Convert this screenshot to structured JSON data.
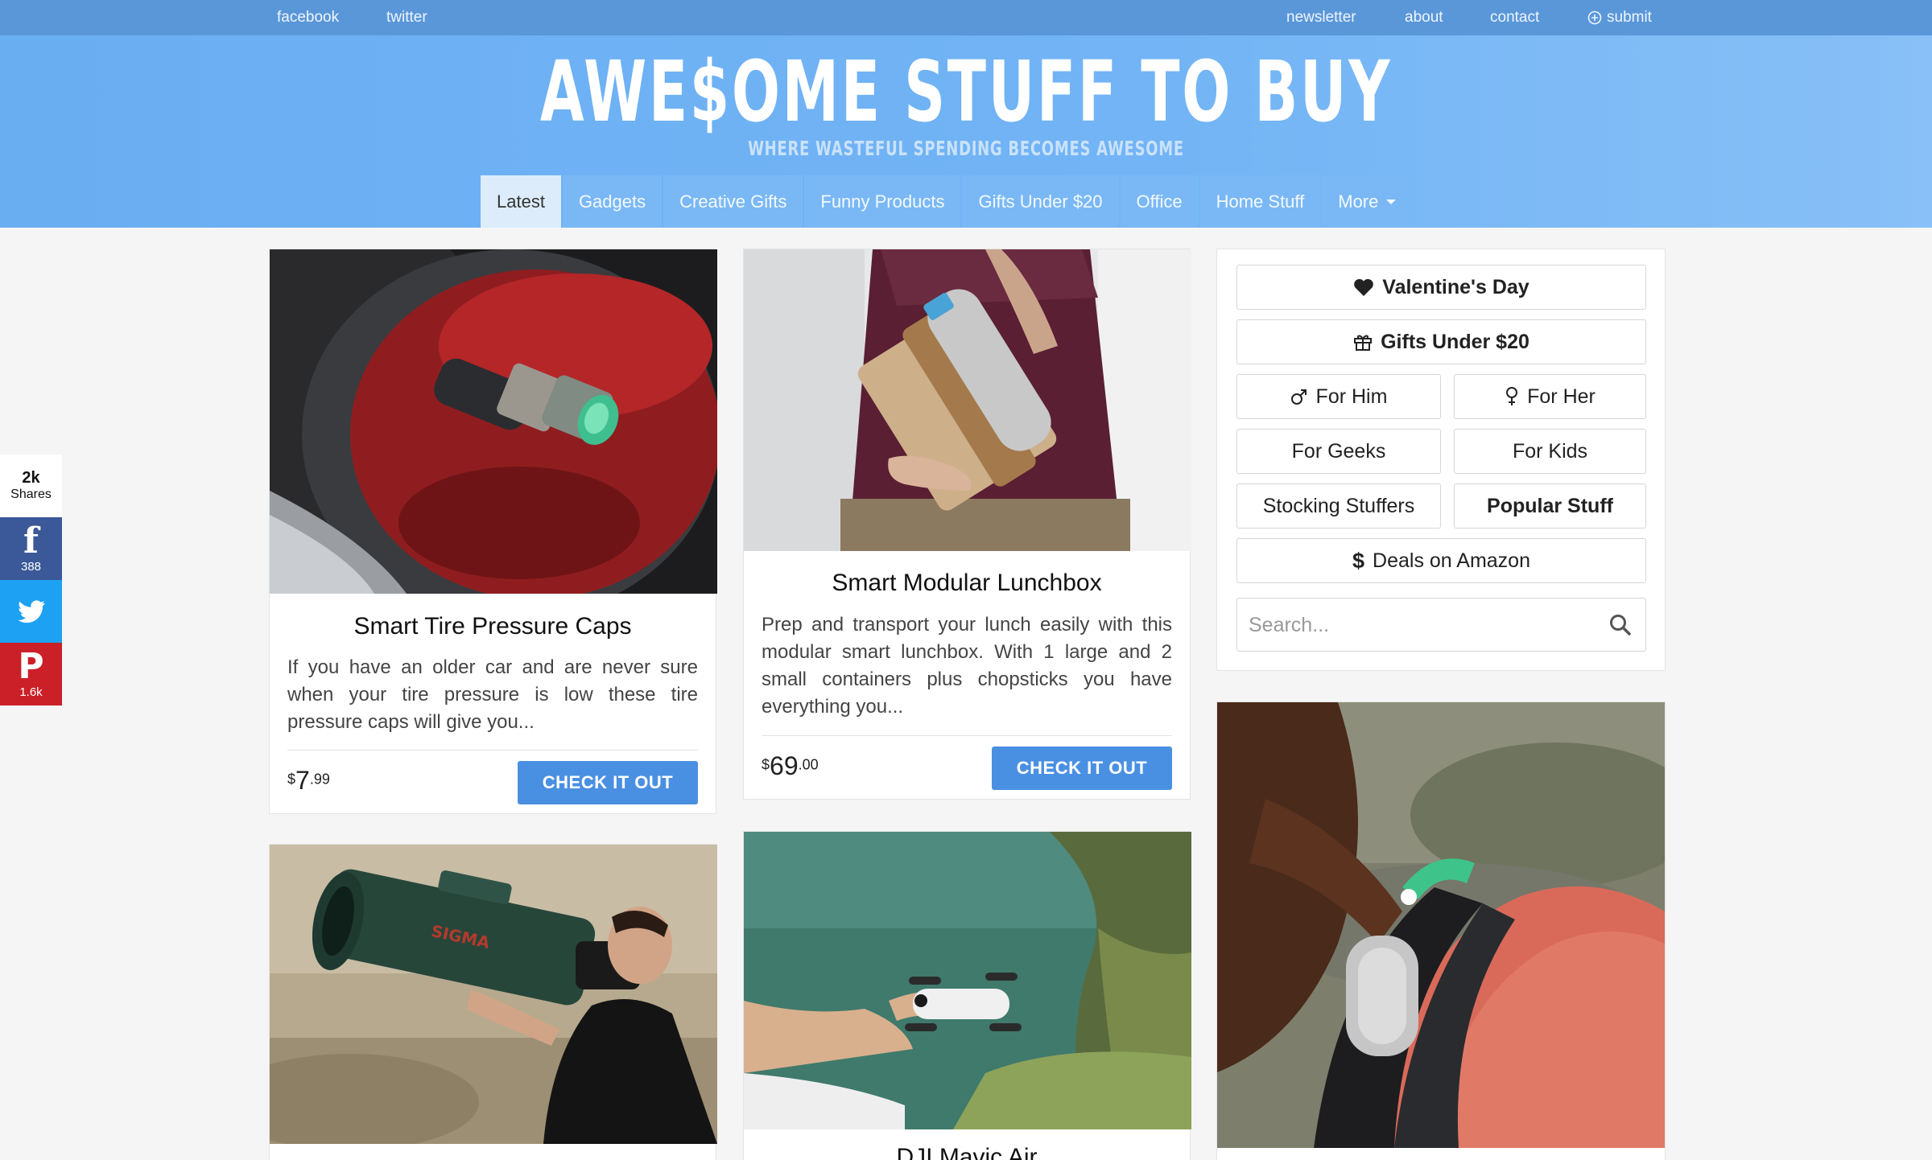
{
  "topbar": {
    "facebook": "facebook",
    "twitter": "twitter",
    "newsletter": "newsletter",
    "about": "about",
    "contact": "contact",
    "submit": "submit"
  },
  "header": {
    "logo": "AWE$OME STUFF TO BUY",
    "tagline": "WHERE WASTEFUL SPENDING BECOMES AWESOME"
  },
  "nav": {
    "tabs": [
      "Latest",
      "Gadgets",
      "Creative Gifts",
      "Funny Products",
      "Gifts Under $20",
      "Office",
      "Home Stuff",
      "More"
    ],
    "active": "Latest"
  },
  "share": {
    "total": "2k",
    "total_label": "Shares",
    "facebook_count": "388",
    "pinterest_count": "1.6k"
  },
  "products": [
    {
      "title": "Smart Tire Pressure Caps",
      "description": "If you have an older car and are never sure when your tire pressure is low these tire pressure caps will give you...",
      "price_currency": "$",
      "price_dollars": "7",
      "price_cents": ".99",
      "cta": "CHECK IT OUT"
    },
    {
      "title": "Smart Modular Lunchbox",
      "description": "Prep and transport your lunch easily with this modular smart lunchbox. With 1 large and 2 small containers plus chopsticks you have everything you...",
      "price_currency": "$",
      "price_dollars": "69",
      "price_cents": ".00",
      "cta": "CHECK IT OUT"
    },
    {
      "title": "DJI Mavic Air"
    }
  ],
  "sidebar": {
    "valentines": "Valentine's Day",
    "gifts_under_20": "Gifts Under $20",
    "for_him": "For Him",
    "for_her": "For Her",
    "for_geeks": "For Geeks",
    "for_kids": "For Kids",
    "stocking_stuffers": "Stocking Stuffers",
    "popular_stuff": "Popular Stuff",
    "deals": "Deals on Amazon",
    "search_placeholder": "Search..."
  }
}
